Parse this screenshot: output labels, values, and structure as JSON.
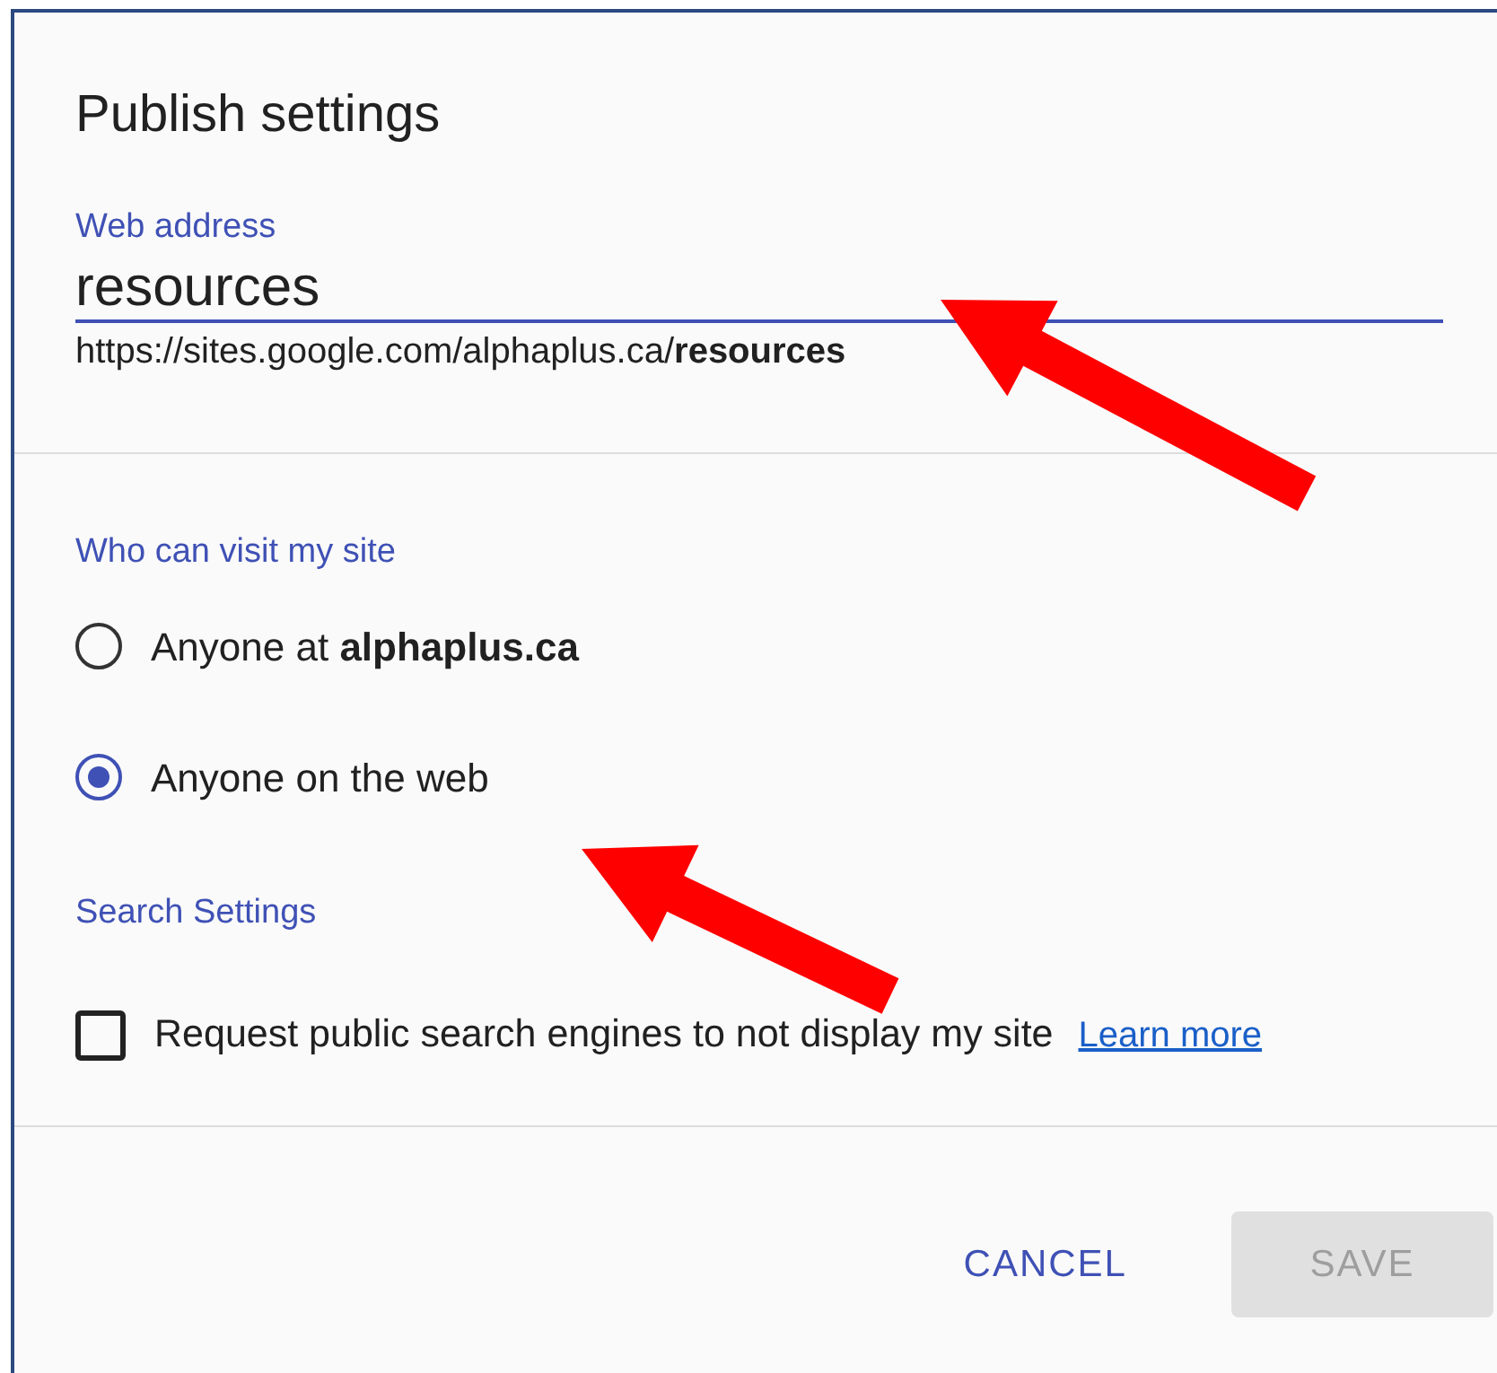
{
  "dialog": {
    "title": "Publish settings"
  },
  "web_address": {
    "label": "Web address",
    "value": "resources",
    "url": "https://sites.google.com/alphaplus.ca/**resources**"
  },
  "visibility": {
    "heading": "Who can visit my site",
    "options": [
      {
        "label": "Anyone at **alphaplus.ca**",
        "selected": false
      },
      {
        "label": "Anyone on the web",
        "selected": true
      }
    ]
  },
  "search_settings": {
    "heading": "Search Settings",
    "checkbox": {
      "label": "Request public search engines to not display my site",
      "checked": false
    },
    "link": "Learn more"
  },
  "buttons": [
    {
      "label": "CANCEL",
      "kind": "text",
      "disabled": false
    },
    {
      "label": "SAVE",
      "kind": "filled",
      "disabled": true
    }
  ],
  "annotations": [
    {
      "kind": "arrow",
      "color": "#ff0000"
    },
    {
      "kind": "arrow",
      "color": "#ff0000"
    }
  ]
}
